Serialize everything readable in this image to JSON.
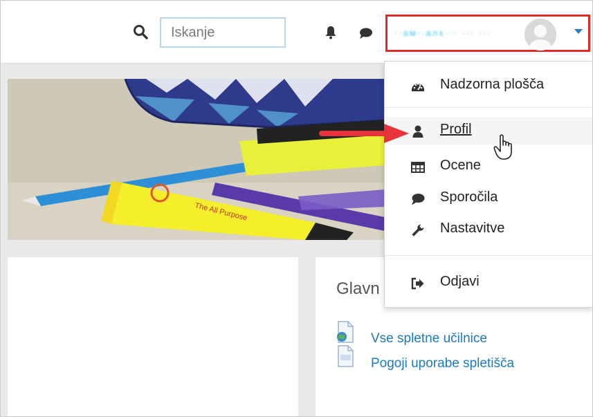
{
  "header": {
    "search": {
      "placeholder": "Iskanje",
      "icon": "search-icon"
    },
    "notifications_icon": "bell-icon",
    "messages_icon": "chat-icon",
    "user_menu": {
      "user_name": "··ам··алх··· ··· ···",
      "avatar_icon": "avatar-placeholder",
      "highlight_color": "#e02a2a",
      "name_color": "#49c5f0"
    }
  },
  "dropdown": {
    "items": [
      {
        "label": "Nadzorna plošča",
        "icon": "dashboard-icon"
      },
      {
        "label": "Profil",
        "icon": "user-icon"
      },
      {
        "label": "Ocene",
        "icon": "grades-table-icon"
      },
      {
        "label": "Sporočila",
        "icon": "speech-bubble-icon"
      },
      {
        "label": "Nastavitve",
        "icon": "wrench-icon"
      },
      {
        "label": "Odjavi",
        "icon": "logout-icon"
      }
    ]
  },
  "block": {
    "title": "Glavn",
    "links": [
      {
        "label": "Vse spletne učilnice",
        "icon": "globe-file-icon"
      },
      {
        "label": "Pogoji uporabe spletišča",
        "icon": "file-icon"
      }
    ]
  },
  "colors": {
    "link": "#1a79c0",
    "arrow": "#e8333a",
    "widget": "#2e3d4d"
  }
}
